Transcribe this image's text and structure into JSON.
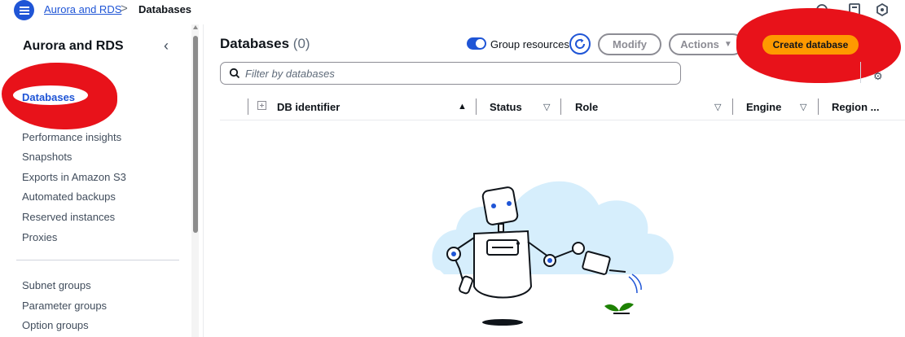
{
  "colors": {
    "primary": "#1f55d6",
    "accent_orange": "#ff9900",
    "annotation_red": "#e8121a",
    "text": "#0f141a",
    "muted": "#414d5c"
  },
  "topbar": {
    "menu_icon": "hamburger-icon",
    "breadcrumb": {
      "parent": "Aurora and RDS",
      "separator": ">",
      "current": "Databases"
    },
    "right_icons": [
      "help-icon",
      "notifications-icon",
      "settings-icon"
    ]
  },
  "sidebar": {
    "title": "Aurora and RDS",
    "close_icon": "chevron-left-icon",
    "items": [
      {
        "label": "Databases",
        "active": true
      },
      {
        "label": "Performance insights",
        "active": false
      },
      {
        "label": "Snapshots",
        "active": false
      },
      {
        "label": "Exports in Amazon S3",
        "active": false
      },
      {
        "label": "Automated backups",
        "active": false
      },
      {
        "label": "Reserved instances",
        "active": false
      },
      {
        "label": "Proxies",
        "active": false
      }
    ],
    "items2": [
      {
        "label": "Subnet groups"
      },
      {
        "label": "Parameter groups"
      },
      {
        "label": "Option groups"
      }
    ]
  },
  "main": {
    "title": "Databases",
    "count": "(0)",
    "group_toggle": {
      "label": "Group resources",
      "on": true
    },
    "refresh_icon": "refresh-icon",
    "modify_label": "Modify",
    "actions_label": "Actions",
    "create_label": "Create database",
    "search": {
      "placeholder": "Filter by databases",
      "value": ""
    },
    "settings_partial": "⚙",
    "table": {
      "columns": [
        "DB identifier",
        "Status",
        "Role",
        "Engine",
        "Region ..."
      ]
    },
    "empty_illustration": "robot-watering-plant-illustration"
  }
}
